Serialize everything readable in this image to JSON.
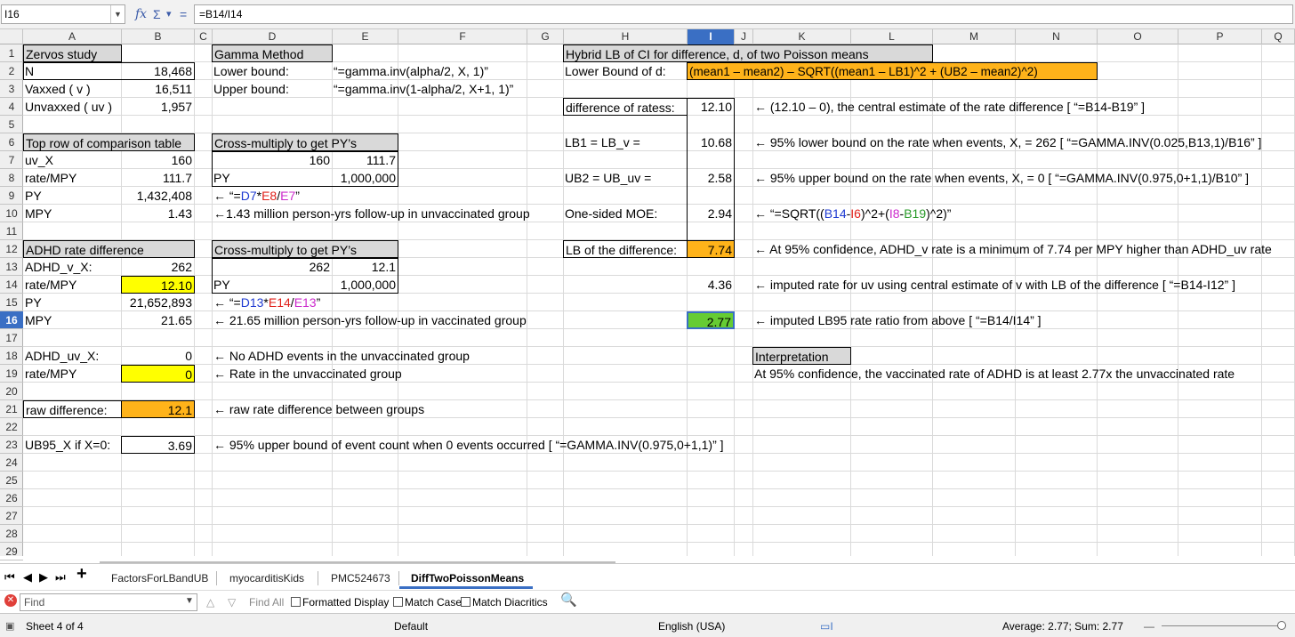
{
  "formula_bar": {
    "name_box": "I16",
    "fx_symbol": "fx",
    "sum_symbol": "Σ",
    "dropdown_symbol": "▾",
    "equals_symbol": "=",
    "formula": "=B14/I14"
  },
  "columns": [
    "A",
    "B",
    "C",
    "D",
    "E",
    "F",
    "G",
    "H",
    "I",
    "J",
    "K",
    "L",
    "M",
    "N",
    "O",
    "P",
    "Q"
  ],
  "selected_column": "I",
  "rows": [
    "1",
    "2",
    "3",
    "4",
    "5",
    "6",
    "7",
    "8",
    "9",
    "10",
    "11",
    "12",
    "13",
    "14",
    "15",
    "16",
    "17",
    "18",
    "19",
    "20",
    "21",
    "22",
    "23",
    "24",
    "25",
    "26",
    "27",
    "28",
    "29"
  ],
  "selected_row": "16",
  "cells": {
    "A1": "Zervos study",
    "A2": "N",
    "B2": "18,468",
    "A3": "Vaxxed ( v )",
    "B3": "16,511",
    "A4": "Unvaxxed ( uv )",
    "B4": "1,957",
    "A6": "Top row of comparison table",
    "A7": "uv_X",
    "B7": "160",
    "A8": "rate/MPY",
    "B8": "111.7",
    "A9": "PY",
    "B9": "1,432,408",
    "A10": "MPY",
    "B10": "1.43",
    "A12": "ADHD rate difference",
    "A13": "ADHD_v_X:",
    "B13": "262",
    "A14": "rate/MPY",
    "B14": "12.10",
    "A15": "PY",
    "B15": "21,652,893",
    "A16": "MPY",
    "B16": "21.65",
    "A18": "ADHD_uv_X:",
    "B18": "0",
    "A19": "rate/MPY",
    "B19": "0",
    "A21": "raw difference:",
    "B21": "12.1",
    "A23": "UB95_X if X=0:",
    "B23": "3.69",
    "D1": "Gamma Method",
    "D2": "Lower bound:",
    "E2": "“=gamma.inv(alpha/2, X, 1)”",
    "D3": "Upper bound:",
    "E3": "“=gamma.inv(1-alpha/2, X+1, 1)”",
    "D6": "Cross-multiply to get PY’s",
    "D7": "160",
    "E7": "111.7",
    "D8": "PY",
    "E8": "1,000,000",
    "D9_arrow": "← “=",
    "D9_p1": "D7",
    "D9_s1": "*",
    "D9_p2": "E8",
    "D9_s2": "/",
    "D9_p3": "E7",
    "D9_end": "”",
    "D10": "←1.43 million person-yrs follow-up in unvaccinated group",
    "D12": "Cross-multiply to get PY’s",
    "D13": "262",
    "E13": "12.1",
    "D14": "PY",
    "E14": "1,000,000",
    "D15_arrow": "← “=",
    "D15_p1": "D13",
    "D15_s1": "*",
    "D15_p2": "E14",
    "D15_s2": "/",
    "D15_p3": "E13",
    "D15_end": "”",
    "D16": "← 21.65 million person-yrs follow-up in vaccinated group",
    "D18": "← No ADHD events in the unvaccinated group",
    "D19": "← Rate in the unvaccinated group",
    "D21": "← raw rate difference between groups",
    "D23": "← 95% upper bound of event count when 0 events occurred [ “=GAMMA.INV(0.975,0+1,1)” ]",
    "H1": "Hybrid LB of CI for difference, d,  of two Poisson means",
    "H2": "Lower Bound of d:",
    "I2": "(mean1 – mean2)  –  SQRT((mean1 – LB1)^2 + (UB2 – mean2)^2)",
    "H4": "difference of ratess:",
    "I4": "12.10",
    "K4": "← (12.10 – 0), the central estimate of the rate difference [ “=B14-B19” ]",
    "H6": "LB1 = LB_v =",
    "I6": "10.68",
    "K6": "← 95% lower bound on the rate when events, X, = 262 [ “=GAMMA.INV(0.025,B13,1)/B16” ]",
    "H8": "UB2 = UB_uv =",
    "I8": "2.58",
    "K8": "← 95% upper bound on the rate when events, X, = 0 [ “=GAMMA.INV(0.975,0+1,1)/B10” ]",
    "H10": "One-sided MOE:",
    "I10": "2.94",
    "K10_a": "← “=SQRT((",
    "K10_b": "B14",
    "K10_c": "-",
    "K10_d": "I6",
    "K10_e": ")^2+(",
    "K10_f": "I8",
    "K10_g": "-",
    "K10_h": "B19",
    "K10_i": ")^2)”",
    "H12": "LB of the difference:",
    "I12": "7.74",
    "K12": "← At 95% confidence, ADHD_v rate is a minimum of 7.74 per MPY higher than ADHD_uv rate",
    "I14": "4.36",
    "K14": "← imputed rate for uv using central estimate of v with LB of the difference [ “=B14-I12” ]",
    "I16": "2.77",
    "K16": "← imputed LB95 rate ratio from above [ “=B14/I14” ]",
    "K18": "Interpretation",
    "K19": "At 95% confidence, the vaccinated rate of ADHD is at least 2.77x the unvaccinated rate"
  },
  "sheet_tabs": [
    "FactorsForLBandUB",
    "myocarditisKids",
    "PMC524673",
    "DiffTwoPoissonMeans"
  ],
  "active_tab": "DiffTwoPoissonMeans",
  "tab_nav": {
    "first": "⏮",
    "prev": "◀",
    "next": "▶",
    "last": "⏭",
    "add": "+"
  },
  "find_bar": {
    "close_symbol": "✕",
    "placeholder": "Find",
    "find_all": "Find All",
    "formatted_display": "Formatted Display",
    "match_case": "Match Case",
    "match_diacritics": "Match Diacritics"
  },
  "status_bar": {
    "sheet": "Sheet 4 of 4",
    "style": "Default",
    "language": "English (USA)",
    "summary": "Average: 2.77; Sum: 2.77"
  },
  "colors": {
    "header_fill": "#d9d9d9",
    "yellow_fill": "#ffff00",
    "orange_fill": "#ffb31a",
    "green_fill": "#66cc33",
    "selection_blue": "#3a6fc4"
  }
}
